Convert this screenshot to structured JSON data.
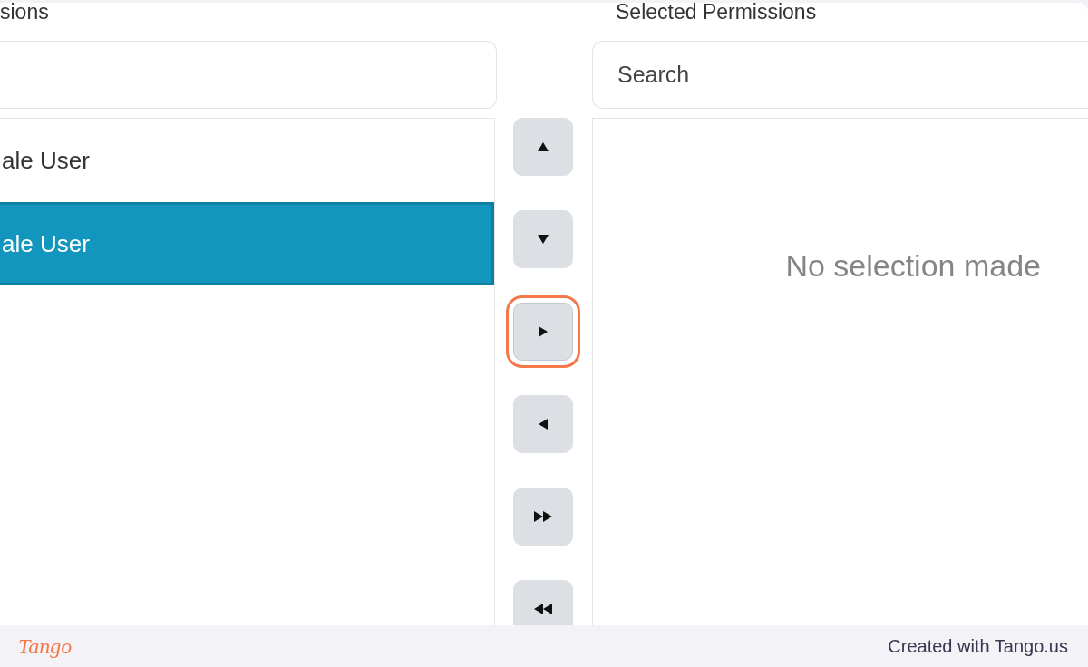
{
  "available": {
    "label": "sions",
    "items": [
      {
        "label": "ale User",
        "selected": false
      },
      {
        "label": "ale User",
        "selected": true
      }
    ]
  },
  "move_buttons": [
    {
      "kind": "up",
      "highlighted": false
    },
    {
      "kind": "down",
      "highlighted": false
    },
    {
      "kind": "right",
      "highlighted": true
    },
    {
      "kind": "left",
      "highlighted": false
    },
    {
      "kind": "all_right",
      "highlighted": false
    },
    {
      "kind": "all_left",
      "highlighted": false
    }
  ],
  "selected": {
    "label": "Selected Permissions",
    "search": {
      "placeholder": "Search"
    },
    "empty_message": "No selection made"
  },
  "footer": {
    "logo": "Tango",
    "credit": "Created with Tango.us"
  }
}
